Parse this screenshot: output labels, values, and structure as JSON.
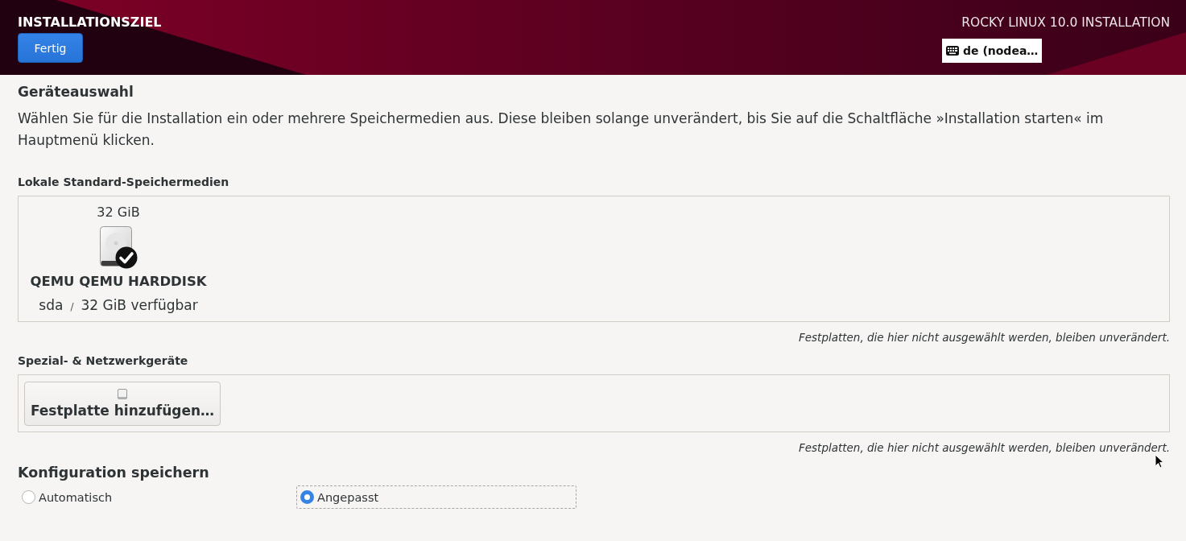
{
  "header": {
    "title": "INSTALLATIONSZIEL",
    "done_button": "Fertig",
    "product": "ROCKY LINUX 10.0 INSTALLATION",
    "keyboard_layout": "de (nodea…"
  },
  "device_selection": {
    "heading": "Geräteauswahl",
    "description": "Wählen Sie für die Installation ein oder mehrere Speichermedien aus. Diese bleiben solange unverändert, bis Sie auf die Schaltfläche »Installation starten« im Hauptmenü klicken.",
    "local": {
      "heading": "Lokale Standard-Speichermedien",
      "disks": [
        {
          "size": "32 GiB",
          "name": "QEMU QEMU HARDDISK",
          "device": "sda",
          "separator": "/",
          "free": "32 GiB verfügbar",
          "selected": true
        }
      ],
      "note": "Festplatten, die hier nicht ausgewählt werden, bleiben unverändert."
    },
    "special": {
      "heading": "Spezial- & Netzwerkgeräte",
      "add_button": "Festplatte hinzufügen…",
      "note": "Festplatten, die hier nicht ausgewählt werden, bleiben unverändert."
    }
  },
  "storage_configuration": {
    "heading": "Konfiguration speichern",
    "options": [
      {
        "label": "Automatisch",
        "selected": false,
        "focused": false
      },
      {
        "label": "Angepasst",
        "selected": true,
        "focused": true
      }
    ]
  }
}
